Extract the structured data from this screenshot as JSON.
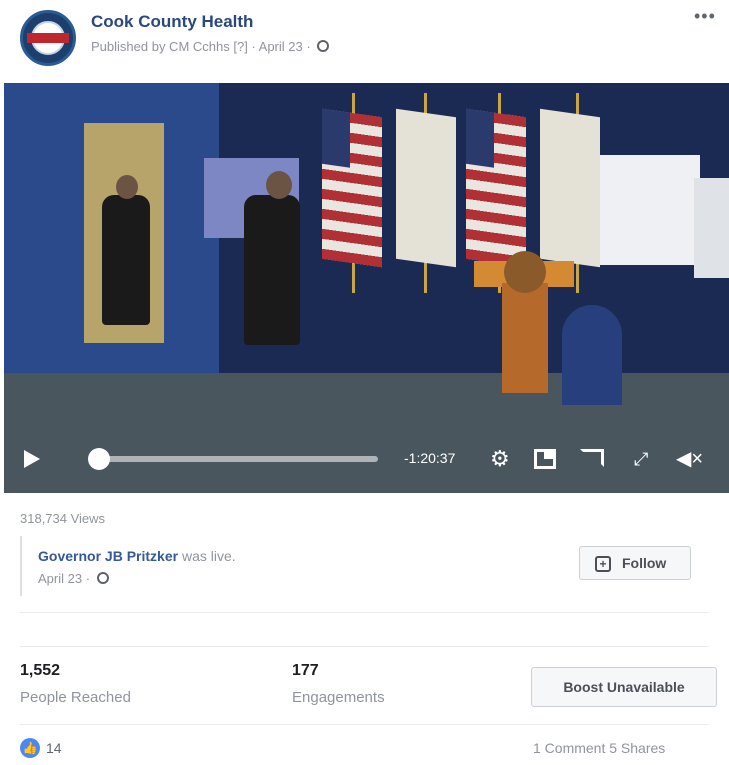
{
  "header": {
    "page_name": "Cook County Health",
    "publish_prefix": "Published by CM Cchhs",
    "publish_date": "April 23",
    "more_label": "•••"
  },
  "video": {
    "time_remaining": "-1:20:37",
    "progress_fraction": 0.0
  },
  "views": "318,734 Views",
  "shared": {
    "author": "Governor JB Pritzker",
    "suffix": " was live.",
    "date": "April 23 ·",
    "follow_label": "Follow"
  },
  "stats": {
    "reached_value": "1,552",
    "reached_label": "People Reached",
    "engagements_value": "177",
    "engagements_label": "Engagements",
    "boost_label": "Boost Unavailable"
  },
  "footer": {
    "like_count": "14",
    "comments_shares": "1 Comment  5 Shares"
  },
  "colors": {
    "page_name": "#29487d",
    "link": "#365899",
    "like_badge": "#4a89f3"
  }
}
